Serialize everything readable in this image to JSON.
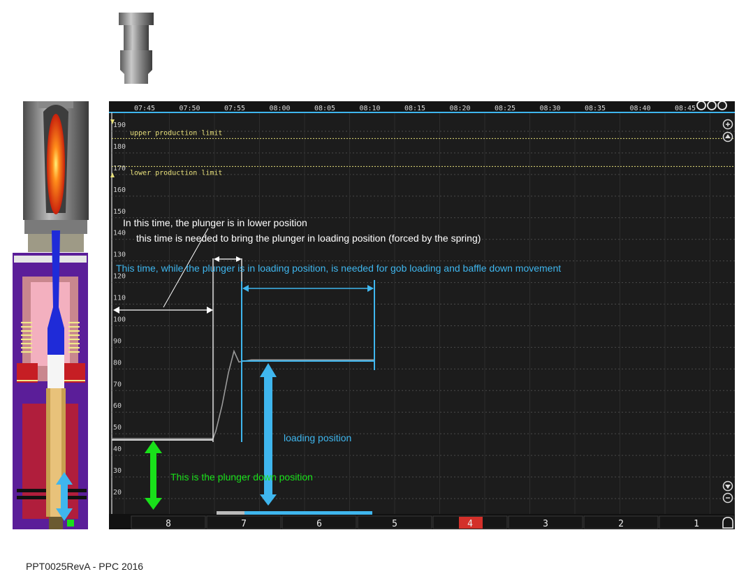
{
  "time_axis": [
    "07:45",
    "07:50",
    "07:55",
    "08:00",
    "08:05",
    "08:10",
    "08:15",
    "08:20",
    "08:25",
    "08:30",
    "08:35",
    "08:40",
    "08:45"
  ],
  "y_ticks": [
    "190",
    "180",
    "170",
    "160",
    "150",
    "140",
    "130",
    "120",
    "110",
    "100",
    "90",
    "80",
    "70",
    "60",
    "50",
    "40",
    "30",
    "20"
  ],
  "limits": {
    "upper": "upper production limit",
    "lower": "lower production limit"
  },
  "annotations": {
    "lower_position": "In this time, the plunger is in lower position",
    "bring_loading": "this time is needed to bring the plunger in loading position (forced by the spring)",
    "gob_loading": "This time, while the plunger is in loading position, is needed for gob loading and baffle down movement",
    "loading_position": "loading position",
    "down_position": "This is the plunger down position"
  },
  "sections": [
    "8",
    "7",
    "6",
    "5",
    "4",
    "3",
    "2",
    "1"
  ],
  "active_section": "4",
  "footer": "PPT0025RevA - PPC 2016",
  "colors": {
    "background": "#1c1c1c",
    "cyan": "#3fb6ee",
    "green": "#19e01a",
    "limit_yellow": "#e8e07a",
    "active_red": "#d3302a",
    "housing_purple": "#5b1e99",
    "spring_red": "#c61e24"
  },
  "chart_data": {
    "type": "line",
    "ylim": [
      15,
      195
    ],
    "y_ticks": [
      190,
      180,
      170,
      160,
      150,
      140,
      130,
      120,
      110,
      100,
      90,
      80,
      70,
      60,
      50,
      40,
      30,
      20
    ],
    "x_ticks": [
      "07:45",
      "07:50",
      "07:55",
      "08:00",
      "08:05",
      "08:10",
      "08:15",
      "08:20",
      "08:25",
      "08:30",
      "08:35",
      "08:40",
      "08:45"
    ],
    "upper_limit": 186,
    "lower_limit": 165,
    "series": [
      {
        "values": [
          45,
          45,
          45,
          45,
          48,
          60,
          75,
          85,
          80,
          81,
          81
        ]
      }
    ]
  }
}
